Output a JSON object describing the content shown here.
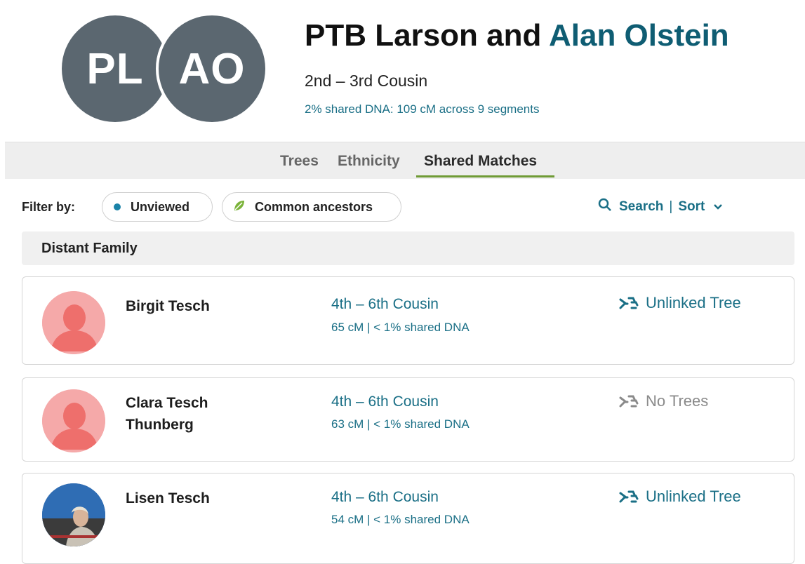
{
  "header": {
    "avatar_left": "PL",
    "avatar_right": "AO",
    "title_part1": "PTB Larson",
    "title_and": " and ",
    "title_part2": "Alan Olstein",
    "relationship": "2nd – 3rd Cousin",
    "shared_dna": "2% shared DNA: 109 cM across 9 segments",
    "avatar_color": "#5b6770",
    "accent_color": "#0f5d73"
  },
  "tabs": [
    {
      "label": "Trees",
      "active": false
    },
    {
      "label": "Ethnicity",
      "active": false
    },
    {
      "label": "Shared Matches",
      "active": true
    }
  ],
  "filters": {
    "label": "Filter by:",
    "unviewed": "Unviewed",
    "common_ancestors": "Common ancestors",
    "search": "Search",
    "separator": "|",
    "sort": "Sort"
  },
  "section": {
    "title": "Distant Family"
  },
  "matches": [
    {
      "name": "Birgit Tesch",
      "relationship": "4th – 6th Cousin",
      "dna": "65 cM | < 1% shared DNA",
      "tree": "Unlinked Tree",
      "avatar": "silhouette-icon"
    },
    {
      "name": "Clara Tesch Thunberg",
      "relationship": "4th – 6th Cousin",
      "dna": "63 cM | < 1% shared DNA",
      "tree": "No Trees",
      "avatar": "silhouette-icon"
    },
    {
      "name": "Lisen Tesch",
      "relationship": "4th – 6th Cousin",
      "dna": "54 cM | < 1% shared DNA",
      "tree": "Unlinked Tree",
      "avatar": "photo"
    }
  ]
}
